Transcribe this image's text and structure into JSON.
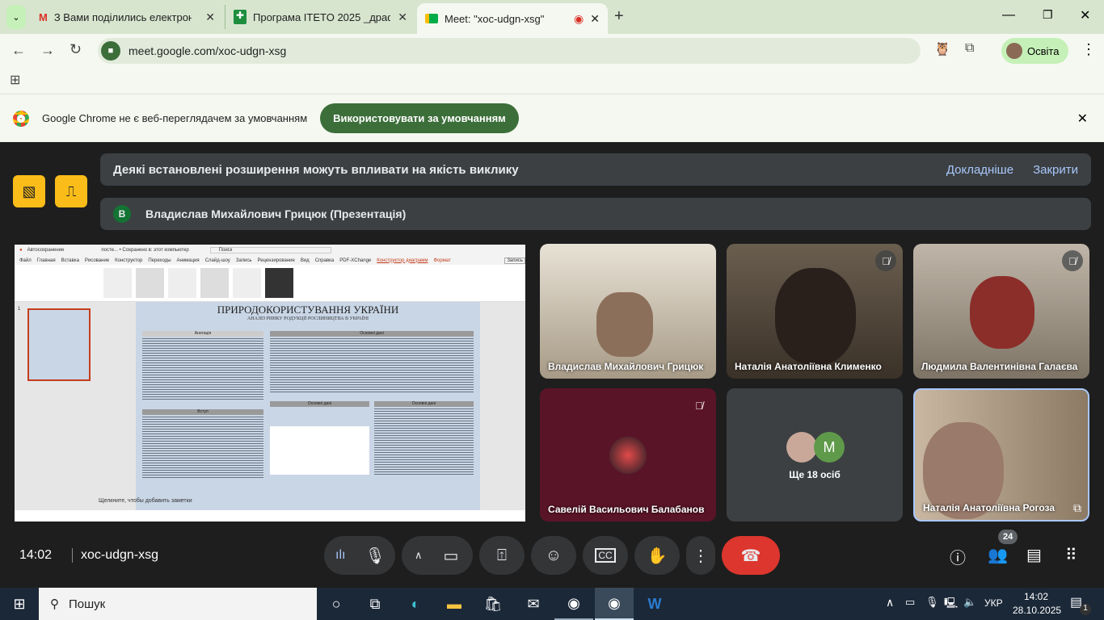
{
  "browser": {
    "tabs": [
      {
        "title": "З Вами поділились електронн",
        "icon": "gmail-icon"
      },
      {
        "title": "Програма ITETO 2025 _драфт -",
        "icon": "sheets-icon"
      },
      {
        "title": "Meet: \"xoc-udgn-xsg\"",
        "icon": "meet-icon",
        "active": true,
        "recording": true
      }
    ],
    "url": "meet.google.com/xoc-udgn-xsg",
    "profile": "Освіта",
    "infobar_text": "Google Chrome не є веб-переглядачем за умовчанням",
    "infobar_button": "Використовувати за умовчанням"
  },
  "meet": {
    "extension_warning": "Деякі встановлені розширення можуть впливати на якість виклику",
    "learn_more": "Докладніше",
    "close": "Закрити",
    "presenter_initial": "В",
    "presenter": "Владислав Михайлович Грицюк (Презентація)",
    "presentation": {
      "app_tabs": [
        "Файл",
        "Главная",
        "Вставка",
        "Рисование",
        "Конструктор",
        "Переходы",
        "Анимация",
        "Слайд-шоу",
        "Запись",
        "Рецензирование",
        "Вид",
        "Справка",
        "PDF-XChange",
        "Конструктор диаграмм",
        "Формат"
      ],
      "search": "Поиск",
      "autosave": "Автосохранение",
      "doc_title": "посте... • Сохранено в: этот компьютер",
      "record": "Запись",
      "slide_title": "ПРИРОДОКОРИСТУВАННЯ УКРАЇНИ",
      "slide_subtitle": "АНАЛІЗ РИНКУ РОДУКЦІЇ РОСЛИНИЦТВА В УКРАЇНІ",
      "sections": [
        "Анотація",
        "Основні дані",
        "Вступ",
        "Основні дані",
        "Основні дані"
      ],
      "notes": "Щелкните, чтобы добавить заметки",
      "slide_num": "1"
    },
    "participants": [
      {
        "name": "Владислав Михайлович Грицюк",
        "muted": false
      },
      {
        "name": "Наталія Анатоліївна Клименко",
        "muted": true
      },
      {
        "name": "Людмила Валентинівна Галаєва",
        "muted": true
      },
      {
        "name": "Савелій Васильович Балабанов",
        "muted": true
      },
      {
        "name": "Наталія Анатоліївна Рогоза",
        "muted": false
      }
    ],
    "others": "Ще 18 осіб",
    "others_initial": "M",
    "time": "14:02",
    "code": "xoc-udgn-xsg",
    "people_count": "24"
  },
  "taskbar": {
    "search": "Пошук",
    "lang": "УКР",
    "time": "14:02",
    "date": "28.10.2025",
    "notifications": "1"
  },
  "colors": {
    "accent": "#3c6e3a",
    "end_call": "#dc362e",
    "warn": "#f9bc18"
  }
}
